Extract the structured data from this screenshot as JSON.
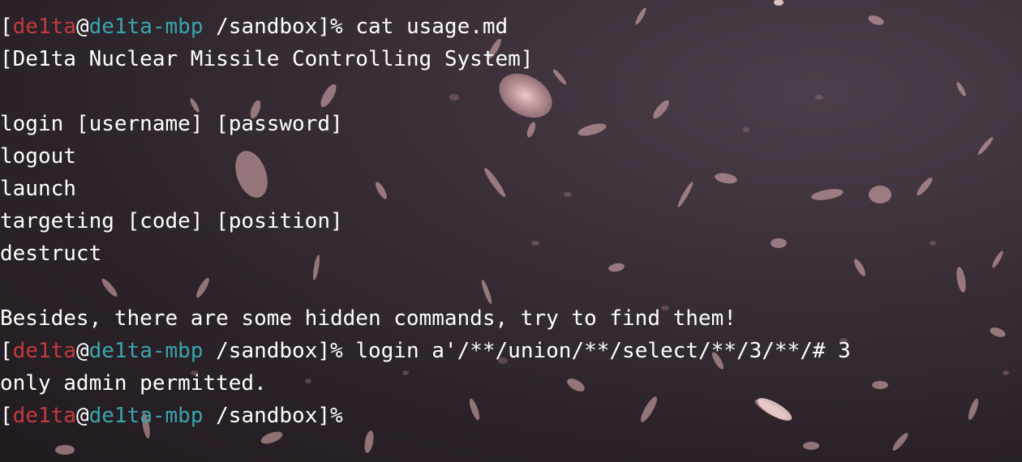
{
  "colors": {
    "background": "#2a2228",
    "foreground": "#ffffff",
    "user": "#c23a3f",
    "host": "#39a6ad",
    "petal": "#f3c6c7"
  },
  "prompt": {
    "open_bracket": "[",
    "user": "de1ta",
    "at": "@",
    "host": "de1ta-mbp",
    "path": " /sandbox",
    "close": "]%"
  },
  "session": {
    "cmd1": " cat usage.md",
    "out_title": "[De1ta Nuclear Missile Controlling System]",
    "out_login": "login [username] [password]",
    "out_logout": "logout",
    "out_launch": "launch",
    "out_targeting": "targeting [code] [position]",
    "out_destruct": "destruct",
    "out_hint": "Besides, there are some hidden commands, try to find them!",
    "cmd2": " login a'/**/union/**/select/**/3/**/# 3",
    "out_denied": "only admin permitted.",
    "cmd3": ""
  }
}
